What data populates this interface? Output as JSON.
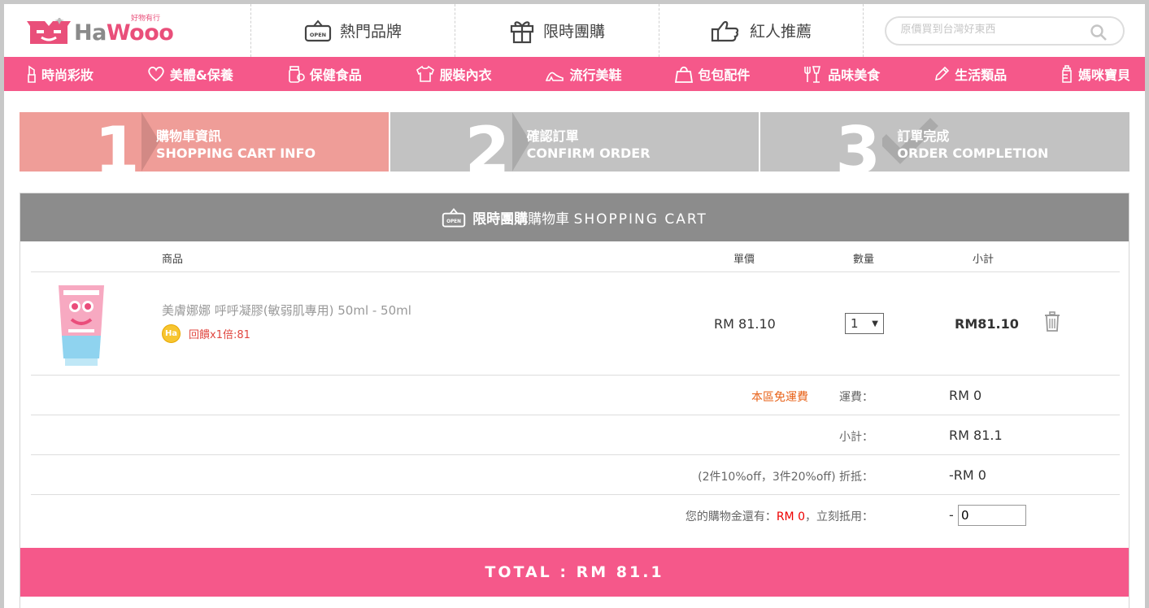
{
  "brand": {
    "name_part1": "Ha",
    "name_part2": "Wooo",
    "tagline": "好物有行",
    "color": "#e94f7a"
  },
  "header_nav": [
    {
      "label": "熱門品牌",
      "icon": "open-sign-icon"
    },
    {
      "label": "限時團購",
      "icon": "gift-icon"
    },
    {
      "label": "紅人推薦",
      "icon": "thumbs-up-icon"
    }
  ],
  "search": {
    "placeholder": "原價買到台灣好東西"
  },
  "categories": [
    {
      "label": "時尚彩妝",
      "icon": "lipstick-icon"
    },
    {
      "label": "美體&保養",
      "icon": "heart-icon"
    },
    {
      "label": "保健食品",
      "icon": "supplement-icon"
    },
    {
      "label": "服裝內衣",
      "icon": "shirt-icon"
    },
    {
      "label": "流行美鞋",
      "icon": "heel-icon"
    },
    {
      "label": "包包配件",
      "icon": "bag-icon"
    },
    {
      "label": "品味美食",
      "icon": "dining-icon"
    },
    {
      "label": "生活類品",
      "icon": "pencil-icon"
    },
    {
      "label": "媽咪寶貝",
      "icon": "baby-bottle-icon"
    }
  ],
  "steps": [
    {
      "num": "1",
      "zh": "購物車資訊",
      "en": "SHOPPING CART INFO",
      "active": true
    },
    {
      "num": "2",
      "zh": "確認訂單",
      "en": "CONFIRM ORDER",
      "active": false
    },
    {
      "num": "3",
      "zh": "訂單完成",
      "en": "ORDER COMPLETION",
      "active": false
    }
  ],
  "cart": {
    "title_strong": "限時團購",
    "title_rest": "購物車",
    "title_en": "SHOPPING CART",
    "columns": {
      "product": "商品",
      "unit_price": "單價",
      "quantity": "數量",
      "subtotal": "小計"
    },
    "items": [
      {
        "name": "美膚娜娜 呼呼凝膠(敏弱肌專用) 50ml - 50ml",
        "badge": "Ha",
        "rebate": "回饋x1倍:81",
        "price": "RM 81.10",
        "qty": "1",
        "subtotal": "RM81.10"
      }
    ],
    "summary": {
      "free_shipping": "本區免運費",
      "shipping_label": "運費：",
      "shipping_value": "RM 0",
      "subtotal_label": "小計：",
      "subtotal_value": "RM 81.1",
      "discount_label": "(2件10%off，3件20%off) 折抵：",
      "discount_value": "-RM 0",
      "credit_label_pre": "您的購物金還有：",
      "credit_amount": "RM 0",
      "credit_label_post": "，立刻抵用：",
      "credit_dash": "-",
      "credit_input": "0"
    },
    "total": "TOTAL : RM 81.1"
  },
  "colors": {
    "pink": "#f5588a",
    "step_active": "#ef9d98",
    "step_inactive": "#c2c2c2",
    "cart_header": "#8c8c8c"
  }
}
